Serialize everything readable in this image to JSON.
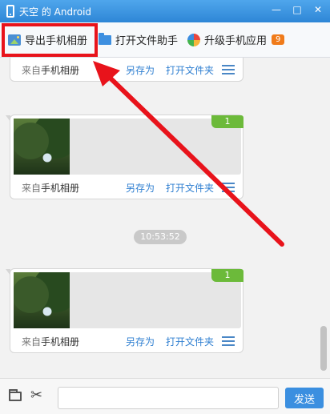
{
  "window": {
    "title": "天空 的 Android",
    "minimize": "—",
    "maximize": "□",
    "close": "✕"
  },
  "toolbar": {
    "export_label": "导出手机相册",
    "open_folder_label": "打开文件助手",
    "upgrade_label": "升级手机应用",
    "upgrade_badge": "9"
  },
  "cards": [
    {
      "from_prefix": "来自",
      "from_name": "手机相册",
      "save_as": "另存为",
      "open_folder": "打开文件夹"
    },
    {
      "count": "1",
      "from_prefix": "来自",
      "from_name": "手机相册",
      "save_as": "另存为",
      "open_folder": "打开文件夹"
    },
    {
      "count": "1",
      "from_prefix": "来自",
      "from_name": "手机相册",
      "save_as": "另存为",
      "open_folder": "打开文件夹"
    }
  ],
  "timestamp": "10:53:52",
  "bottom": {
    "input_value": "",
    "send_label": "发送"
  },
  "colors": {
    "titlebar": "#2e86d6",
    "highlight": "#e8131b",
    "link": "#2f7fd1",
    "count_badge": "#6cba3a",
    "upgrade_badge": "#f07b1a"
  }
}
